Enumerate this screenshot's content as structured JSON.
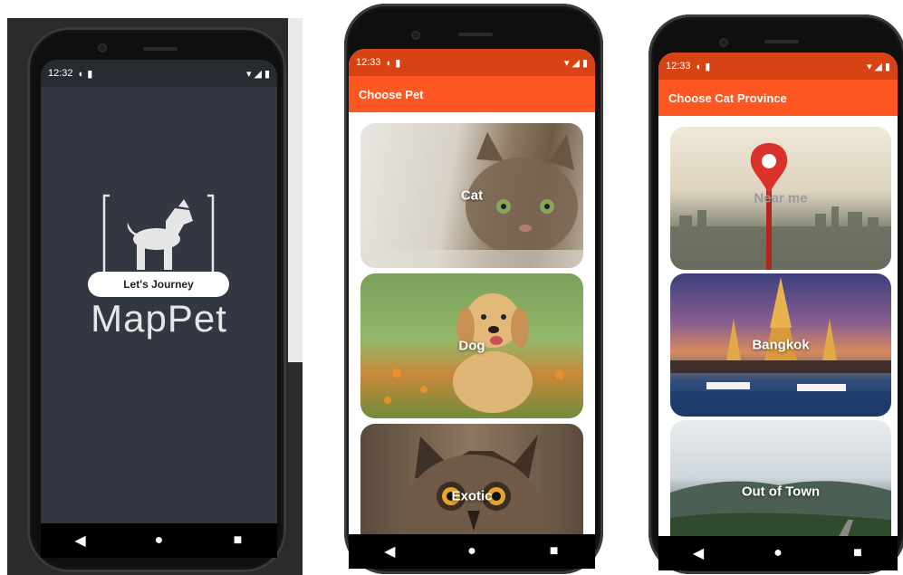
{
  "splash": {
    "status_time": "12:32",
    "button_label": "Let's Journey",
    "app_name": "MapPet",
    "bg_color": "#323741"
  },
  "pets": {
    "status_time": "12:33",
    "title": "Choose Pet",
    "items": [
      {
        "label": "Cat"
      },
      {
        "label": "Dog"
      },
      {
        "label": "Exotic"
      }
    ]
  },
  "province": {
    "status_time": "12:33",
    "title": "Choose Cat Province",
    "items": [
      {
        "label": "Near me"
      },
      {
        "label": "Bangkok"
      },
      {
        "label": "Out of Town"
      }
    ]
  },
  "colors": {
    "accent": "#FF5722",
    "status_bar": "#D84315"
  },
  "nav_icons": [
    "back-icon",
    "home-icon",
    "recents-icon"
  ]
}
